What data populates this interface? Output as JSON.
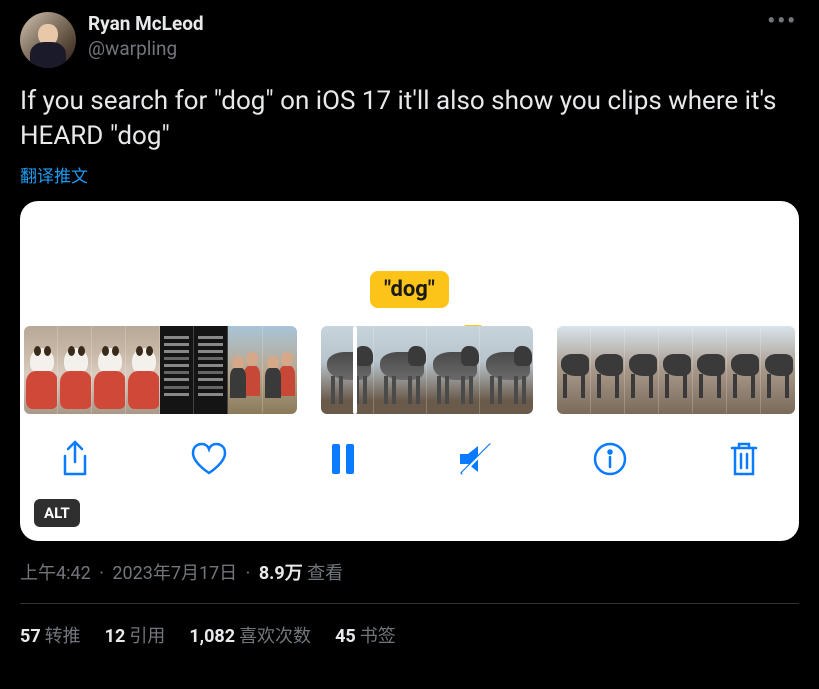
{
  "author": {
    "display_name": "Ryan McLeod",
    "handle": "@warpling"
  },
  "tweet_text": "If you search for \"dog\" on iOS 17 it'll also show you clips where it's HEARD \"dog\"",
  "translate_label": "翻译推文",
  "media": {
    "search_token": "\"dog\"",
    "alt_badge": "ALT"
  },
  "meta": {
    "time": "上午4:42",
    "date": "2023年7月17日",
    "views_number": "8.9万",
    "views_label": "查看"
  },
  "stats": {
    "retweets_num": "57",
    "retweets_label": "转推",
    "quotes_num": "12",
    "quotes_label": "引用",
    "likes_num": "1,082",
    "likes_label": "喜欢次数",
    "bookmarks_num": "45",
    "bookmarks_label": "书签"
  }
}
